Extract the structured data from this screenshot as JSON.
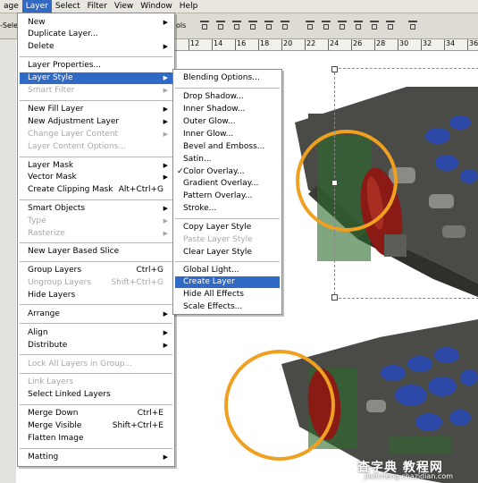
{
  "menubar": {
    "items": [
      {
        "label": "age",
        "active": false
      },
      {
        "label": "Layer",
        "active": true
      },
      {
        "label": "Select",
        "active": false
      },
      {
        "label": "Filter",
        "active": false
      },
      {
        "label": "View",
        "active": false
      },
      {
        "label": "Window",
        "active": false
      },
      {
        "label": "Help",
        "active": false
      }
    ]
  },
  "optbar": {
    "left_text": "-Sele",
    "right_text": "ols"
  },
  "ruler": {
    "ticks": [
      "12",
      "14",
      "16",
      "18",
      "20",
      "22",
      "24",
      "26",
      "28",
      "30",
      "32",
      "34",
      "36"
    ]
  },
  "layer_menu": {
    "items": [
      {
        "label": "New",
        "shortcut": "",
        "submenu": true,
        "disabled": false
      },
      {
        "label": "Duplicate Layer...",
        "shortcut": "",
        "submenu": false,
        "disabled": false
      },
      {
        "label": "Delete",
        "shortcut": "",
        "submenu": true,
        "disabled": false
      },
      {
        "label": "Layer Properties...",
        "shortcut": "",
        "submenu": false,
        "disabled": false
      },
      {
        "label": "Layer Style",
        "shortcut": "",
        "submenu": true,
        "disabled": false,
        "highlight": true
      },
      {
        "label": "Smart Filter",
        "shortcut": "",
        "submenu": true,
        "disabled": true
      },
      {
        "label": "New Fill Layer",
        "shortcut": "",
        "submenu": true,
        "disabled": false
      },
      {
        "label": "New Adjustment Layer",
        "shortcut": "",
        "submenu": true,
        "disabled": false
      },
      {
        "label": "Change Layer Content",
        "shortcut": "",
        "submenu": true,
        "disabled": true
      },
      {
        "label": "Layer Content Options...",
        "shortcut": "",
        "submenu": false,
        "disabled": true
      },
      {
        "label": "Layer Mask",
        "shortcut": "",
        "submenu": true,
        "disabled": false
      },
      {
        "label": "Vector Mask",
        "shortcut": "",
        "submenu": true,
        "disabled": false
      },
      {
        "label": "Create Clipping Mask",
        "shortcut": "Alt+Ctrl+G",
        "submenu": false,
        "disabled": false
      },
      {
        "label": "Smart Objects",
        "shortcut": "",
        "submenu": true,
        "disabled": false
      },
      {
        "label": "Type",
        "shortcut": "",
        "submenu": true,
        "disabled": true
      },
      {
        "label": "Rasterize",
        "shortcut": "",
        "submenu": true,
        "disabled": true
      },
      {
        "label": "New Layer Based Slice",
        "shortcut": "",
        "submenu": false,
        "disabled": false
      },
      {
        "label": "Group Layers",
        "shortcut": "Ctrl+G",
        "submenu": false,
        "disabled": false
      },
      {
        "label": "Ungroup Layers",
        "shortcut": "Shift+Ctrl+G",
        "submenu": false,
        "disabled": true
      },
      {
        "label": "Hide Layers",
        "shortcut": "",
        "submenu": false,
        "disabled": false
      },
      {
        "label": "Arrange",
        "shortcut": "",
        "submenu": true,
        "disabled": false
      },
      {
        "label": "Align",
        "shortcut": "",
        "submenu": true,
        "disabled": false
      },
      {
        "label": "Distribute",
        "shortcut": "",
        "submenu": true,
        "disabled": false
      },
      {
        "label": "Lock All Layers in Group...",
        "shortcut": "",
        "submenu": false,
        "disabled": true
      },
      {
        "label": "Link Layers",
        "shortcut": "",
        "submenu": false,
        "disabled": true
      },
      {
        "label": "Select Linked Layers",
        "shortcut": "",
        "submenu": false,
        "disabled": false
      },
      {
        "label": "Merge Down",
        "shortcut": "Ctrl+E",
        "submenu": false,
        "disabled": false
      },
      {
        "label": "Merge Visible",
        "shortcut": "Shift+Ctrl+E",
        "submenu": false,
        "disabled": false
      },
      {
        "label": "Flatten Image",
        "shortcut": "",
        "submenu": false,
        "disabled": false
      },
      {
        "label": "Matting",
        "shortcut": "",
        "submenu": true,
        "disabled": false
      }
    ]
  },
  "style_menu": {
    "items": [
      {
        "label": "Blending Options...",
        "disabled": false
      },
      {
        "label": "Drop Shadow...",
        "disabled": false
      },
      {
        "label": "Inner Shadow...",
        "disabled": false
      },
      {
        "label": "Outer Glow...",
        "disabled": false
      },
      {
        "label": "Inner Glow...",
        "disabled": false
      },
      {
        "label": "Bevel and Emboss...",
        "disabled": false
      },
      {
        "label": "Satin...",
        "disabled": false
      },
      {
        "label": "Color Overlay...",
        "disabled": false,
        "checked": true
      },
      {
        "label": "Gradient Overlay...",
        "disabled": false
      },
      {
        "label": "Pattern Overlay...",
        "disabled": false
      },
      {
        "label": "Stroke...",
        "disabled": false
      },
      {
        "label": "Copy Layer Style",
        "disabled": false
      },
      {
        "label": "Paste Layer Style",
        "disabled": true
      },
      {
        "label": "Clear Layer Style",
        "disabled": false
      },
      {
        "label": "Global Light...",
        "disabled": false
      },
      {
        "label": "Create Layer",
        "disabled": false,
        "highlight": true
      },
      {
        "label": "Hide All Effects",
        "disabled": false
      },
      {
        "label": "Scale Effects...",
        "disabled": false
      }
    ]
  },
  "watermark": {
    "line1": "查字典 教程网",
    "line2": "jiaocheng.chazidian.com"
  },
  "colors": {
    "highlight": "#316ac5",
    "circle": "#f0a020",
    "device": "#4a4a46",
    "buttons": "#2c49a8",
    "red_part": "#8a1a14"
  }
}
